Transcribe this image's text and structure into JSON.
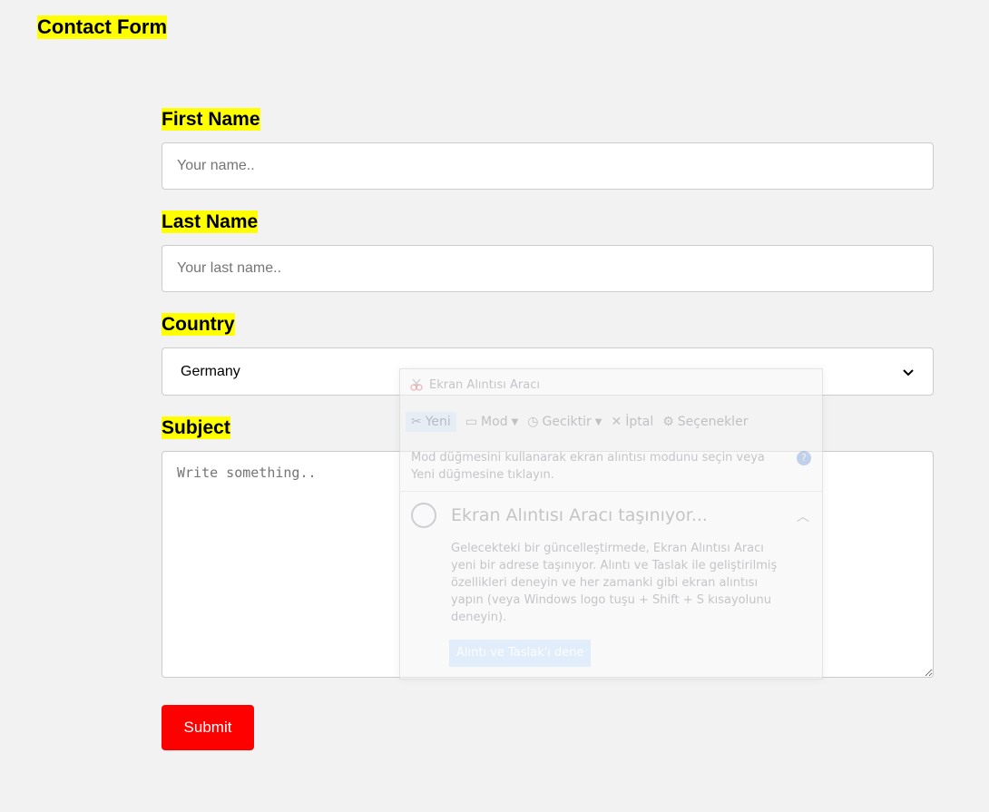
{
  "form": {
    "title": "Contact Form",
    "first_name_label": "First Name",
    "first_name_placeholder": "Your name..",
    "last_name_label": "Last Name",
    "last_name_placeholder": "Your last name..",
    "country_label": "Country",
    "country_selected": "Germany",
    "subject_label": "Subject",
    "subject_placeholder": "Write something..",
    "submit_label": "Submit",
    "accent_color": "#ff0000",
    "highlight_color": "#ffff00"
  },
  "snipping_tool": {
    "title": "Ekran Alıntısı Aracı",
    "toolbar": {
      "new": "Yeni",
      "mode": "Mod",
      "delay": "Geciktir",
      "cancel": "İptal",
      "options": "Seçenekler"
    },
    "hint": "Mod düğmesini kullanarak ekran alıntısı modunu seçin veya Yeni düğmesine tıklayın.",
    "moving_title": "Ekran Alıntısı Aracı taşınıyor...",
    "moving_body": "Gelecekteki bir güncelleştirmede, Ekran Alıntısı Aracı yeni bir adrese taşınıyor. Alıntı ve Taslak ile geliştirilmiş özellikleri deneyin ve her zamanki gibi ekran alıntısı yapın (veya Windows logo tuşu + Shift + S kısayolunu deneyin).",
    "try_button": "Alıntı ve Taslak'ı dene"
  }
}
